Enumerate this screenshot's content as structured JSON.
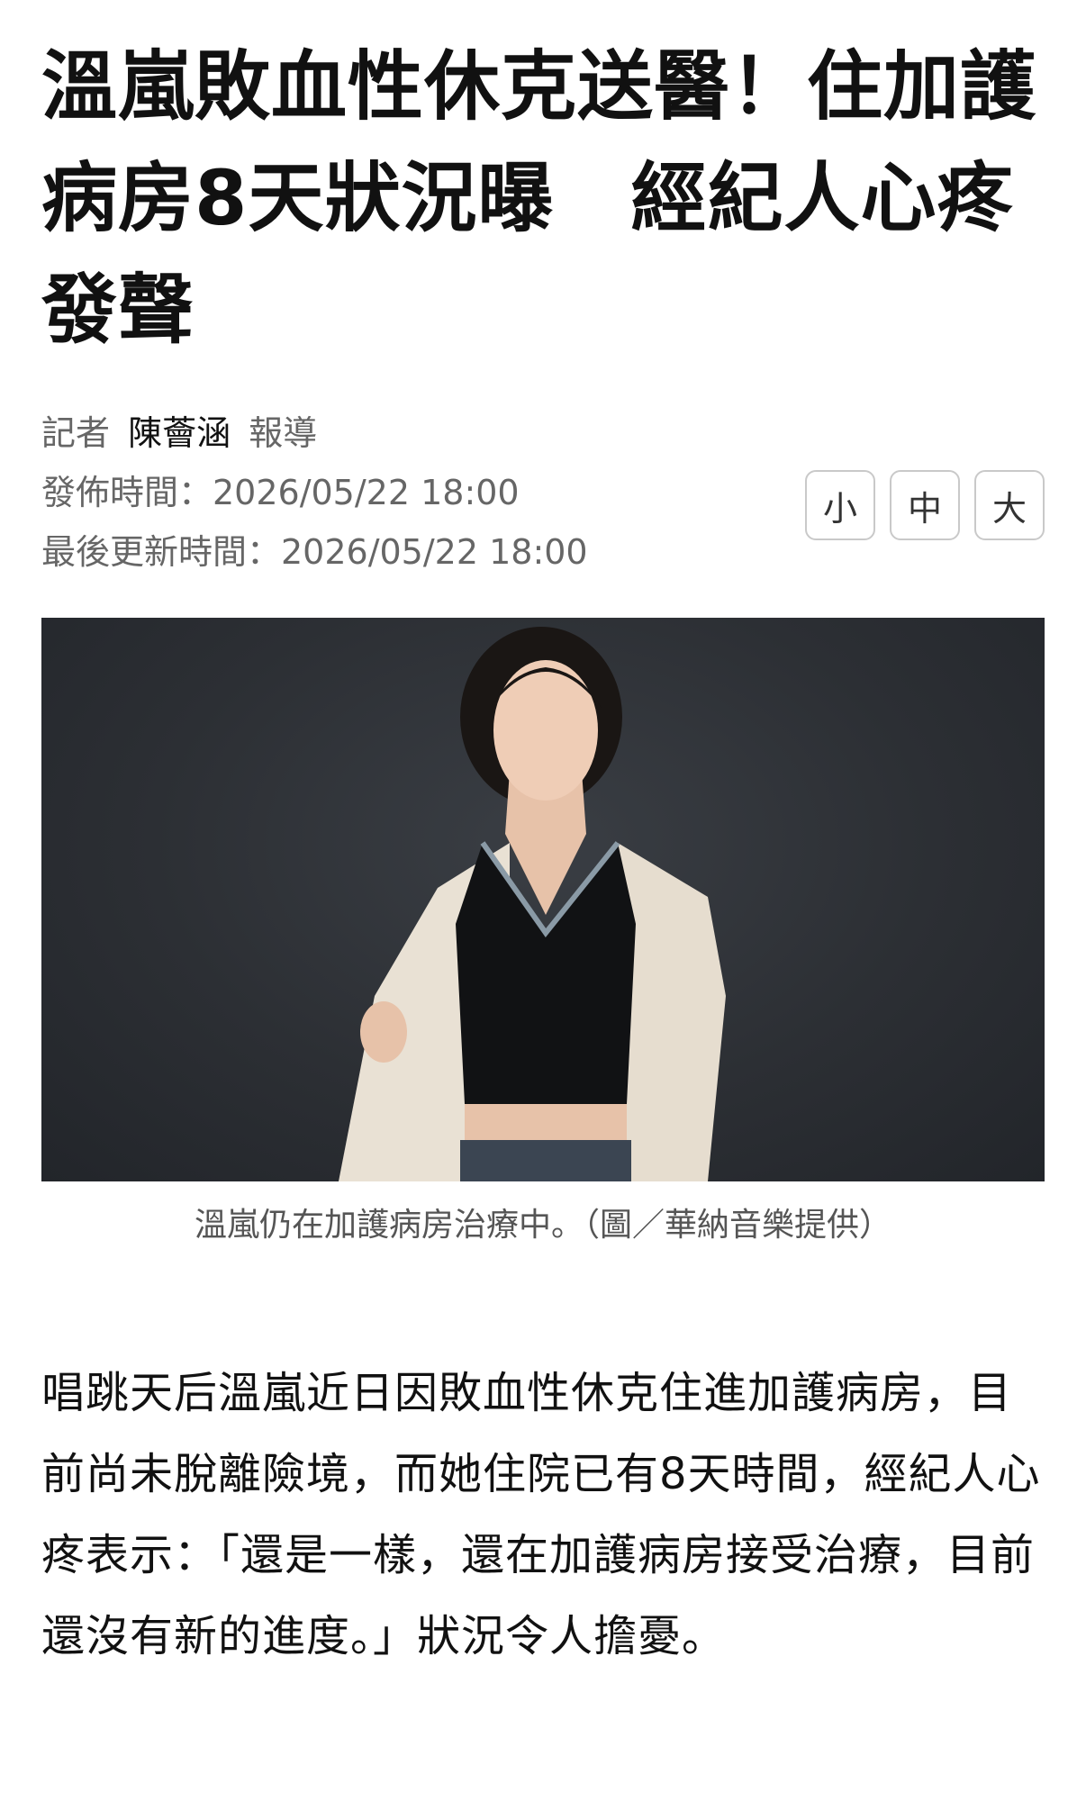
{
  "article": {
    "headline": "溫嵐敗血性休克送醫！住加護病房8天狀況曝　經紀人心疼發聲",
    "byline": {
      "prefix": "記者",
      "reporter": "陳薈涵",
      "suffix": "報導"
    },
    "published": "發佈時間：2026/05/22 18:00",
    "updated": "最後更新時間：2026/05/22 18:00",
    "font_size_options": [
      "小",
      "中",
      "大"
    ],
    "photo": {
      "icon": "photo-image",
      "caption": "溫嵐仍在加護病房治療中。（圖／華納音樂提供）"
    },
    "body": "唱跳天后溫嵐近日因敗血性休克住進加護病房，目前尚未脫離險境，而她住院已有8天時間，經紀人心疼表示：「還是一樣，還在加護病房接受治療，目前還沒有新的進度。」狀況令人擔憂。"
  },
  "colors": {
    "headline": "#111111",
    "meta": "#666666",
    "photo_background": "#2c2f34",
    "button_border": "#c9c9c9"
  }
}
